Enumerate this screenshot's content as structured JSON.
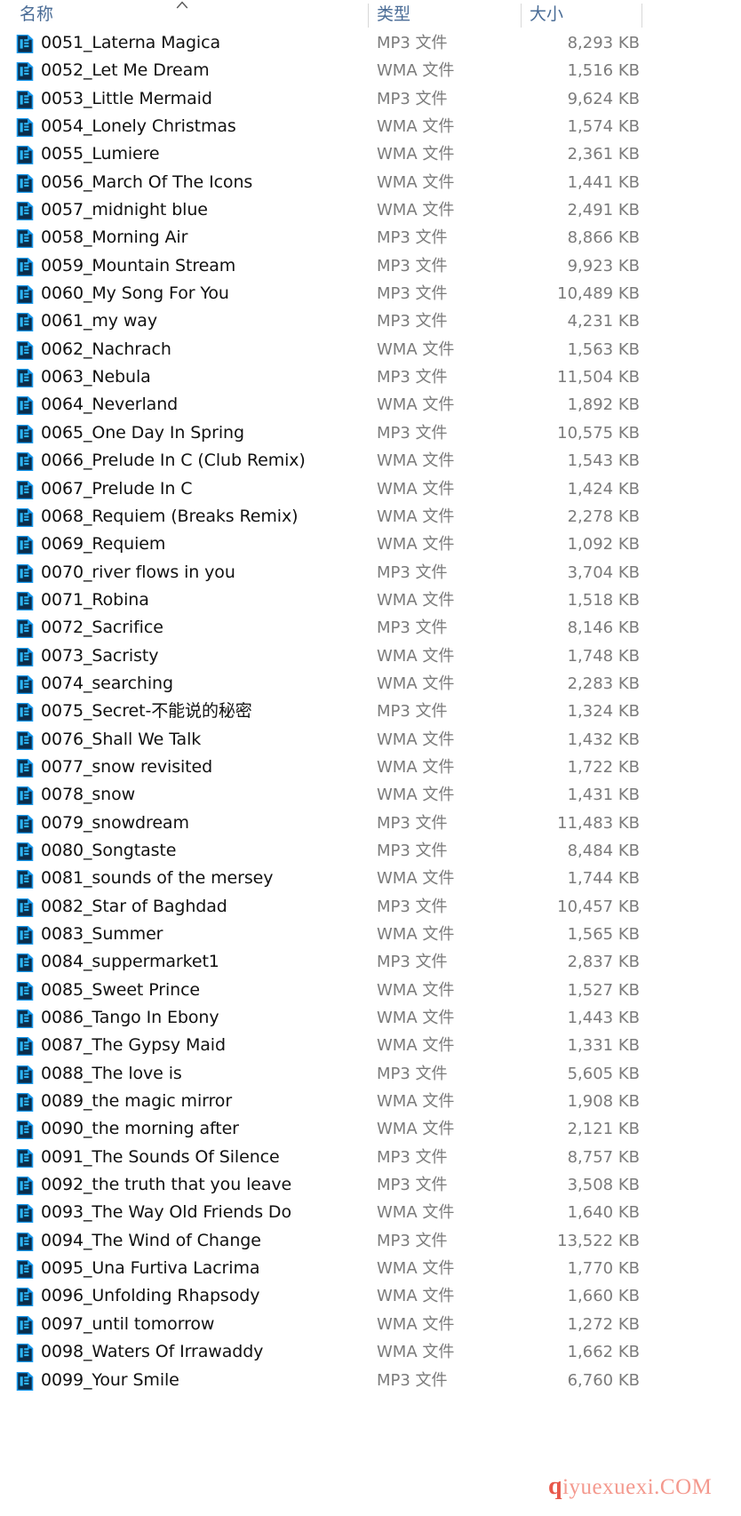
{
  "window": {
    "view": "details",
    "app": "File Explorer"
  },
  "columns": {
    "name": "名称",
    "type": "类型",
    "size": "大小",
    "sort_column": "名称",
    "sort_direction": "ascending",
    "sort_icon": "caret-up-icon",
    "divider_color": "#d8d8d8",
    "header_color": "#4a6c96"
  },
  "colors": {
    "icon_blue": "#1a9cf0",
    "icon_dark": "#0b2d4a",
    "text": "#111111",
    "muted": "#7b7b7b",
    "watermark": "#f4998e",
    "watermark_accent": "#e8574a"
  },
  "icons": {
    "file_icon": "media-file-icon"
  },
  "files": [
    {
      "name": "0051_Laterna Magica",
      "type": "MP3 文件",
      "size": "8,293 KB"
    },
    {
      "name": "0052_Let Me Dream",
      "type": "WMA 文件",
      "size": "1,516 KB"
    },
    {
      "name": "0053_Little Mermaid",
      "type": "MP3 文件",
      "size": "9,624 KB"
    },
    {
      "name": "0054_Lonely Christmas",
      "type": "WMA 文件",
      "size": "1,574 KB"
    },
    {
      "name": "0055_Lumiere",
      "type": "WMA 文件",
      "size": "2,361 KB"
    },
    {
      "name": "0056_March Of The Icons",
      "type": "WMA 文件",
      "size": "1,441 KB"
    },
    {
      "name": "0057_midnight blue",
      "type": "WMA 文件",
      "size": "2,491 KB"
    },
    {
      "name": "0058_Morning Air",
      "type": "MP3 文件",
      "size": "8,866 KB"
    },
    {
      "name": "0059_Mountain Stream",
      "type": "MP3 文件",
      "size": "9,923 KB"
    },
    {
      "name": "0060_My Song For You",
      "type": "MP3 文件",
      "size": "10,489 KB"
    },
    {
      "name": "0061_my way",
      "type": "MP3 文件",
      "size": "4,231 KB"
    },
    {
      "name": "0062_Nachrach",
      "type": "WMA 文件",
      "size": "1,563 KB"
    },
    {
      "name": "0063_Nebula",
      "type": "MP3 文件",
      "size": "11,504 KB"
    },
    {
      "name": "0064_Neverland",
      "type": "WMA 文件",
      "size": "1,892 KB"
    },
    {
      "name": "0065_One Day In Spring",
      "type": "MP3 文件",
      "size": "10,575 KB"
    },
    {
      "name": "0066_Prelude In C (Club Remix)",
      "type": "WMA 文件",
      "size": "1,543 KB"
    },
    {
      "name": "0067_Prelude In C",
      "type": "WMA 文件",
      "size": "1,424 KB"
    },
    {
      "name": "0068_Requiem (Breaks Remix)",
      "type": "WMA 文件",
      "size": "2,278 KB"
    },
    {
      "name": "0069_Requiem",
      "type": "WMA 文件",
      "size": "1,092 KB"
    },
    {
      "name": "0070_river flows in you",
      "type": "MP3 文件",
      "size": "3,704 KB"
    },
    {
      "name": "0071_Robina",
      "type": "WMA 文件",
      "size": "1,518 KB"
    },
    {
      "name": "0072_Sacrifice",
      "type": "MP3 文件",
      "size": "8,146 KB"
    },
    {
      "name": "0073_Sacristy",
      "type": "WMA 文件",
      "size": "1,748 KB"
    },
    {
      "name": "0074_searching",
      "type": "WMA 文件",
      "size": "2,283 KB"
    },
    {
      "name": "0075_Secret-不能说的秘密",
      "type": "MP3 文件",
      "size": "1,324 KB"
    },
    {
      "name": "0076_Shall We Talk",
      "type": "WMA 文件",
      "size": "1,432 KB"
    },
    {
      "name": "0077_snow revisited",
      "type": "WMA 文件",
      "size": "1,722 KB"
    },
    {
      "name": "0078_snow",
      "type": "WMA 文件",
      "size": "1,431 KB"
    },
    {
      "name": "0079_snowdream",
      "type": "MP3 文件",
      "size": "11,483 KB"
    },
    {
      "name": "0080_Songtaste",
      "type": "MP3 文件",
      "size": "8,484 KB"
    },
    {
      "name": "0081_sounds of the mersey",
      "type": "WMA 文件",
      "size": "1,744 KB"
    },
    {
      "name": "0082_Star of Baghdad",
      "type": "MP3 文件",
      "size": "10,457 KB"
    },
    {
      "name": "0083_Summer",
      "type": "WMA 文件",
      "size": "1,565 KB"
    },
    {
      "name": "0084_suppermarket1",
      "type": "MP3 文件",
      "size": "2,837 KB"
    },
    {
      "name": "0085_Sweet Prince",
      "type": "WMA 文件",
      "size": "1,527 KB"
    },
    {
      "name": "0086_Tango In Ebony",
      "type": "WMA 文件",
      "size": "1,443 KB"
    },
    {
      "name": "0087_The Gypsy Maid",
      "type": "WMA 文件",
      "size": "1,331 KB"
    },
    {
      "name": "0088_The love is",
      "type": "MP3 文件",
      "size": "5,605 KB"
    },
    {
      "name": "0089_the magic mirror",
      "type": "WMA 文件",
      "size": "1,908 KB"
    },
    {
      "name": "0090_the morning after",
      "type": "WMA 文件",
      "size": "2,121 KB"
    },
    {
      "name": "0091_The Sounds Of Silence",
      "type": "MP3 文件",
      "size": "8,757 KB"
    },
    {
      "name": "0092_the truth that you leave",
      "type": "MP3 文件",
      "size": "3,508 KB"
    },
    {
      "name": "0093_The Way Old Friends Do",
      "type": "WMA 文件",
      "size": "1,640 KB"
    },
    {
      "name": "0094_The Wind of Change",
      "type": "MP3 文件",
      "size": "13,522 KB"
    },
    {
      "name": "0095_Una Furtiva Lacrima",
      "type": "WMA 文件",
      "size": "1,770 KB"
    },
    {
      "name": "0096_Unfolding Rhapsody",
      "type": "WMA 文件",
      "size": "1,660 KB"
    },
    {
      "name": "0097_until tomorrow",
      "type": "WMA 文件",
      "size": "1,272 KB"
    },
    {
      "name": "0098_Waters Of Irrawaddy",
      "type": "WMA 文件",
      "size": "1,662 KB"
    },
    {
      "name": "0099_Your Smile",
      "type": "MP3 文件",
      "size": "6,760 KB"
    }
  ],
  "watermark": {
    "accent": "q",
    "rest": "iyuexuexi.COM"
  }
}
